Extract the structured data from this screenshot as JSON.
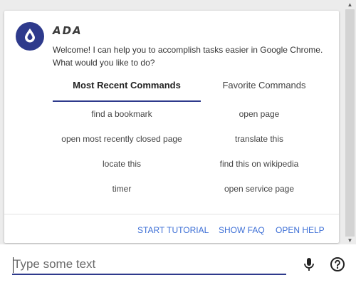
{
  "assistant": {
    "name": "ADA",
    "welcome": "Welcome! I can help you to accomplish tasks easier in Google Chrome. What would you like to do?"
  },
  "tabs": [
    {
      "label": "Most Recent Commands",
      "active": true
    },
    {
      "label": "Favorite Commands",
      "active": false
    }
  ],
  "commands": {
    "recent": [
      "find a bookmark",
      "open most recently closed page",
      "locate this",
      "timer"
    ],
    "favorite": [
      "open page",
      "translate this",
      "find this on wikipedia",
      "open service page"
    ]
  },
  "actions": {
    "tutorial": "START TUTORIAL",
    "faq": "SHOW FAQ",
    "help": "OPEN HELP"
  },
  "input": {
    "placeholder": "Type some text",
    "value": ""
  },
  "icons": {
    "avatar": "droplet-icon",
    "mic": "microphone-icon",
    "help": "help-circle-icon"
  },
  "colors": {
    "accent": "#2e3a8c",
    "link": "#3d6fd6",
    "background": "#ececec"
  }
}
